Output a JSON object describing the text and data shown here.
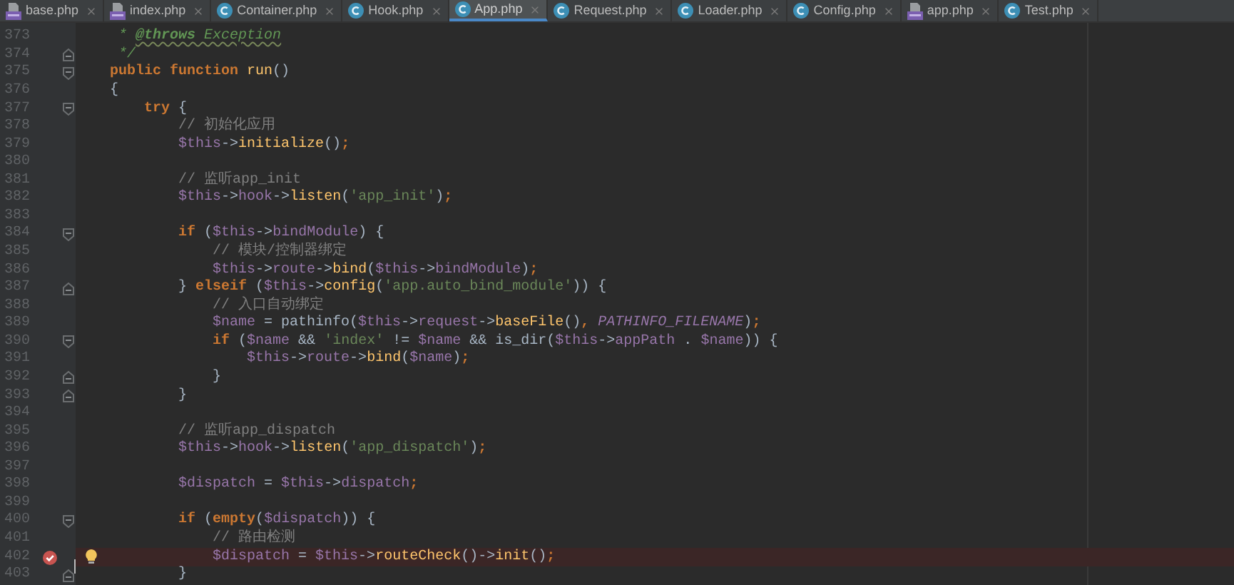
{
  "tabs": [
    {
      "label": "base.php",
      "kind": "php",
      "selected": false
    },
    {
      "label": "index.php",
      "kind": "php",
      "selected": false
    },
    {
      "label": "Container.php",
      "kind": "class",
      "selected": false
    },
    {
      "label": "Hook.php",
      "kind": "class",
      "selected": false
    },
    {
      "label": "App.php",
      "kind": "class",
      "selected": true
    },
    {
      "label": "Request.php",
      "kind": "class",
      "selected": false
    },
    {
      "label": "Loader.php",
      "kind": "class",
      "selected": false
    },
    {
      "label": "Config.php",
      "kind": "class",
      "selected": false
    },
    {
      "label": "app.php",
      "kind": "php",
      "selected": false
    },
    {
      "label": "Test.php",
      "kind": "class",
      "selected": false
    }
  ],
  "lines": [
    {
      "number": "373",
      "breakpoint": false,
      "bulb": false,
      "tokens": [
        {
          "kind": "doc",
          "text": "     * "
        },
        {
          "kind": "doctag",
          "text": "@throws"
        },
        {
          "kind": "doctype",
          "text": " Exception"
        }
      ]
    },
    {
      "number": "374",
      "fold_end": true,
      "breakpoint": false,
      "bulb": false,
      "tokens": [
        {
          "kind": "doc",
          "text": "     */"
        }
      ]
    },
    {
      "number": "375",
      "fold_start": true,
      "breakpoint": false,
      "bulb": false,
      "tokens": [
        {
          "kind": "keyword",
          "text": "    public function "
        },
        {
          "kind": "function",
          "text": "run"
        },
        {
          "kind": "plain",
          "text": "()"
        }
      ]
    },
    {
      "number": "376",
      "breakpoint": false,
      "bulb": false,
      "tokens": [
        {
          "kind": "plain",
          "text": "    {"
        }
      ]
    },
    {
      "number": "377",
      "fold_start": true,
      "breakpoint": false,
      "bulb": false,
      "tokens": [
        {
          "kind": "keyword",
          "text": "        try "
        },
        {
          "kind": "plain",
          "text": "{"
        }
      ]
    },
    {
      "number": "378",
      "breakpoint": false,
      "bulb": false,
      "tokens": [
        {
          "kind": "comment",
          "text": "            // 初始化应用"
        }
      ]
    },
    {
      "number": "379",
      "breakpoint": false,
      "bulb": false,
      "tokens": [
        {
          "kind": "variable",
          "text": "            $this"
        },
        {
          "kind": "plain",
          "text": "->"
        },
        {
          "kind": "function",
          "text": "initialize"
        },
        {
          "kind": "plain",
          "text": "()"
        },
        {
          "kind": "keyword",
          "text": ";"
        }
      ]
    },
    {
      "number": "380",
      "breakpoint": false,
      "bulb": false
    },
    {
      "number": "381",
      "breakpoint": false,
      "bulb": false,
      "tokens": [
        {
          "kind": "comment",
          "text": "            // 监听app_init"
        }
      ]
    },
    {
      "number": "382",
      "breakpoint": false,
      "bulb": false,
      "tokens": [
        {
          "kind": "variable",
          "text": "            $this"
        },
        {
          "kind": "plain",
          "text": "->"
        },
        {
          "kind": "variable",
          "text": "hook"
        },
        {
          "kind": "plain",
          "text": "->"
        },
        {
          "kind": "function",
          "text": "listen"
        },
        {
          "kind": "plain",
          "text": "("
        },
        {
          "kind": "string",
          "text": "'app_init'"
        },
        {
          "kind": "plain",
          "text": ")"
        },
        {
          "kind": "keyword",
          "text": ";"
        }
      ]
    },
    {
      "number": "383",
      "breakpoint": false,
      "bulb": false
    },
    {
      "number": "384",
      "fold_start": true,
      "breakpoint": false,
      "bulb": false,
      "tokens": [
        {
          "kind": "keyword",
          "text": "            if "
        },
        {
          "kind": "plain",
          "text": "("
        },
        {
          "kind": "variable",
          "text": "$this"
        },
        {
          "kind": "plain",
          "text": "->"
        },
        {
          "kind": "variable",
          "text": "bindModule"
        },
        {
          "kind": "plain",
          "text": ") {"
        }
      ]
    },
    {
      "number": "385",
      "breakpoint": false,
      "bulb": false,
      "tokens": [
        {
          "kind": "comment",
          "text": "                // 模块/控制器绑定"
        }
      ]
    },
    {
      "number": "386",
      "breakpoint": false,
      "bulb": false,
      "tokens": [
        {
          "kind": "variable",
          "text": "                $this"
        },
        {
          "kind": "plain",
          "text": "->"
        },
        {
          "kind": "variable",
          "text": "route"
        },
        {
          "kind": "plain",
          "text": "->"
        },
        {
          "kind": "function",
          "text": "bind"
        },
        {
          "kind": "plain",
          "text": "("
        },
        {
          "kind": "variable",
          "text": "$this"
        },
        {
          "kind": "plain",
          "text": "->"
        },
        {
          "kind": "variable",
          "text": "bindModule"
        },
        {
          "kind": "plain",
          "text": ")"
        },
        {
          "kind": "keyword",
          "text": ";"
        }
      ]
    },
    {
      "number": "387",
      "fold_end": true,
      "breakpoint": false,
      "bulb": false,
      "tokens": [
        {
          "kind": "plain",
          "text": "            } "
        },
        {
          "kind": "keyword",
          "text": "elseif "
        },
        {
          "kind": "plain",
          "text": "("
        },
        {
          "kind": "variable",
          "text": "$this"
        },
        {
          "kind": "plain",
          "text": "->"
        },
        {
          "kind": "function",
          "text": "config"
        },
        {
          "kind": "plain",
          "text": "("
        },
        {
          "kind": "string",
          "text": "'app.auto_bind_module'"
        },
        {
          "kind": "plain",
          "text": ")) {"
        }
      ]
    },
    {
      "number": "388",
      "breakpoint": false,
      "bulb": false,
      "tokens": [
        {
          "kind": "comment",
          "text": "                // 入口自动绑定"
        }
      ]
    },
    {
      "number": "389",
      "breakpoint": false,
      "bulb": false,
      "tokens": [
        {
          "kind": "variable",
          "text": "                $name"
        },
        {
          "kind": "plain",
          "text": " = pathinfo("
        },
        {
          "kind": "variable",
          "text": "$this"
        },
        {
          "kind": "plain",
          "text": "->"
        },
        {
          "kind": "variable",
          "text": "request"
        },
        {
          "kind": "plain",
          "text": "->"
        },
        {
          "kind": "function",
          "text": "baseFile"
        },
        {
          "kind": "plain",
          "text": "()"
        },
        {
          "kind": "keyword",
          "text": ", "
        },
        {
          "kind": "constant",
          "text": "PATHINFO_FILENAME"
        },
        {
          "kind": "plain",
          "text": ")"
        },
        {
          "kind": "keyword",
          "text": ";"
        }
      ]
    },
    {
      "number": "390",
      "fold_start": true,
      "breakpoint": false,
      "bulb": false,
      "tokens": [
        {
          "kind": "keyword",
          "text": "                if "
        },
        {
          "kind": "plain",
          "text": "("
        },
        {
          "kind": "variable",
          "text": "$name"
        },
        {
          "kind": "plain",
          "text": " && "
        },
        {
          "kind": "string",
          "text": "'index'"
        },
        {
          "kind": "plain",
          "text": " != "
        },
        {
          "kind": "variable",
          "text": "$name"
        },
        {
          "kind": "plain",
          "text": " && is_dir("
        },
        {
          "kind": "variable",
          "text": "$this"
        },
        {
          "kind": "plain",
          "text": "->"
        },
        {
          "kind": "variable",
          "text": "appPath"
        },
        {
          "kind": "plain",
          "text": " . "
        },
        {
          "kind": "variable",
          "text": "$name"
        },
        {
          "kind": "plain",
          "text": ")) {"
        }
      ]
    },
    {
      "number": "391",
      "breakpoint": false,
      "bulb": false,
      "tokens": [
        {
          "kind": "variable",
          "text": "                    $this"
        },
        {
          "kind": "plain",
          "text": "->"
        },
        {
          "kind": "variable",
          "text": "route"
        },
        {
          "kind": "plain",
          "text": "->"
        },
        {
          "kind": "function",
          "text": "bind"
        },
        {
          "kind": "plain",
          "text": "("
        },
        {
          "kind": "variable",
          "text": "$name"
        },
        {
          "kind": "plain",
          "text": ")"
        },
        {
          "kind": "keyword",
          "text": ";"
        }
      ]
    },
    {
      "number": "392",
      "fold_end": true,
      "breakpoint": false,
      "bulb": false,
      "tokens": [
        {
          "kind": "plain",
          "text": "                }"
        }
      ]
    },
    {
      "number": "393",
      "fold_end": true,
      "breakpoint": false,
      "bulb": false,
      "tokens": [
        {
          "kind": "plain",
          "text": "            }"
        }
      ]
    },
    {
      "number": "394",
      "breakpoint": false,
      "bulb": false
    },
    {
      "number": "395",
      "breakpoint": false,
      "bulb": false,
      "tokens": [
        {
          "kind": "comment",
          "text": "            // 监听app_dispatch"
        }
      ]
    },
    {
      "number": "396",
      "breakpoint": false,
      "bulb": false,
      "tokens": [
        {
          "kind": "variable",
          "text": "            $this"
        },
        {
          "kind": "plain",
          "text": "->"
        },
        {
          "kind": "variable",
          "text": "hook"
        },
        {
          "kind": "plain",
          "text": "->"
        },
        {
          "kind": "function",
          "text": "listen"
        },
        {
          "kind": "plain",
          "text": "("
        },
        {
          "kind": "string",
          "text": "'app_dispatch'"
        },
        {
          "kind": "plain",
          "text": ")"
        },
        {
          "kind": "keyword",
          "text": ";"
        }
      ]
    },
    {
      "number": "397",
      "breakpoint": false,
      "bulb": false
    },
    {
      "number": "398",
      "breakpoint": false,
      "bulb": false,
      "tokens": [
        {
          "kind": "variable",
          "text": "            $dispatch"
        },
        {
          "kind": "plain",
          "text": " = "
        },
        {
          "kind": "variable",
          "text": "$this"
        },
        {
          "kind": "plain",
          "text": "->"
        },
        {
          "kind": "variable",
          "text": "dispatch"
        },
        {
          "kind": "keyword",
          "text": ";"
        }
      ]
    },
    {
      "number": "399",
      "breakpoint": false,
      "bulb": false
    },
    {
      "number": "400",
      "fold_start": true,
      "breakpoint": false,
      "bulb": false,
      "tokens": [
        {
          "kind": "keyword",
          "text": "            if "
        },
        {
          "kind": "plain",
          "text": "("
        },
        {
          "kind": "keyword",
          "text": "empty"
        },
        {
          "kind": "plain",
          "text": "("
        },
        {
          "kind": "variable",
          "text": "$dispatch"
        },
        {
          "kind": "plain",
          "text": ")) {"
        }
      ]
    },
    {
      "number": "401",
      "breakpoint": false,
      "bulb": false,
      "tokens": [
        {
          "kind": "comment",
          "text": "                // 路由检测"
        }
      ]
    },
    {
      "number": "402",
      "breakpoint": true,
      "bulb": true,
      "tokens": [
        {
          "kind": "variable",
          "text": "                $dispatch"
        },
        {
          "kind": "plain",
          "text": " = "
        },
        {
          "kind": "variable",
          "text": "$this"
        },
        {
          "kind": "plain",
          "text": "->"
        },
        {
          "kind": "function",
          "text": "routeCheck"
        },
        {
          "kind": "plain",
          "text": "()->"
        },
        {
          "kind": "function",
          "text": "init"
        },
        {
          "kind": "plain",
          "text": "()"
        },
        {
          "kind": "keyword",
          "text": ";"
        }
      ]
    },
    {
      "number": "403",
      "fold_end": true,
      "breakpoint": false,
      "bulb": false,
      "tokens": [
        {
          "kind": "plain",
          "text": "            }"
        }
      ]
    }
  ]
}
